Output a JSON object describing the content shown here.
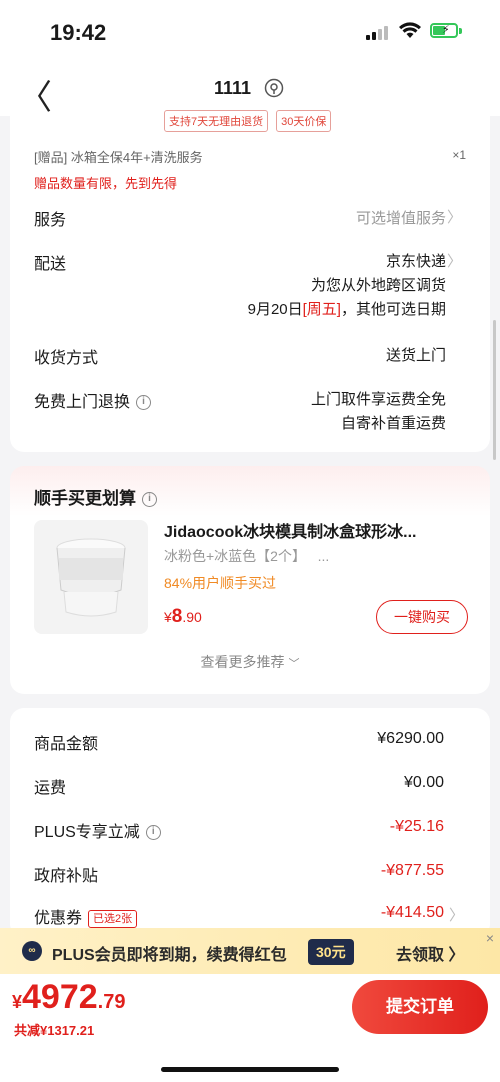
{
  "status": {
    "time": "19:42"
  },
  "nav": {
    "title": "1111",
    "back_icon": "chevron-left-icon",
    "location_icon": "location-pin-icon"
  },
  "order": {
    "tags": [
      "支持7天无理由退货",
      "30天价保"
    ],
    "gift": "[赠品] 冰箱全保4年+清洗服务",
    "gift_qty": "×1",
    "gift_note": "赠品数量有限，先到先得",
    "service": {
      "label": "服务",
      "value": "可选增值服务"
    },
    "delivery": {
      "label": "配送",
      "value": "京东快递",
      "line2": "为您从外地跨区调货",
      "line3_pre": "9月20日",
      "line3_day": "[周五]",
      "line3_post": "，其他可选日期"
    },
    "receive": {
      "label": "收货方式",
      "value": "送货上门"
    },
    "free_return": {
      "label": "免费上门退换",
      "line1": "上门取件享运费全免",
      "line2": "自寄补首重运费"
    }
  },
  "recommend": {
    "title": "顺手买更划算",
    "product": {
      "name": "Jidaocook冰块模具制冰盒球形冰...",
      "spec": "冰粉色+冰蓝色【2个】",
      "spec_more": "...",
      "rate": "84%用户顺手买过",
      "price_symbol": "¥",
      "price_int": "8",
      "price_dec": ".90",
      "buy_label": "一键购买"
    },
    "more_label": "查看更多推荐"
  },
  "fees": {
    "goods": {
      "label": "商品金额",
      "value": "¥6290.00"
    },
    "shipping": {
      "label": "运费",
      "value": "¥0.00"
    },
    "plus": {
      "label": "PLUS专享立减",
      "value": "-¥25.16"
    },
    "gov": {
      "label": "政府补贴",
      "value": "-¥877.55"
    },
    "coupon": {
      "label": "优惠券",
      "tag": "已选2张",
      "value": "-¥414.50"
    }
  },
  "plus_banner": {
    "text": "PLUS会员即将到期，续费得红包",
    "badge": "30元",
    "action": "去领取 〉",
    "close": "×"
  },
  "bottom": {
    "price_symbol": "¥",
    "price_int": "4972",
    "price_dec": ".79",
    "saved": "共减¥1317.21",
    "submit": "提交订单"
  },
  "colors": {
    "accent": "#e0201c",
    "orange": "#f08a24",
    "plus_dark": "#1f2b4a",
    "plus_bg": "#fde7a6"
  }
}
